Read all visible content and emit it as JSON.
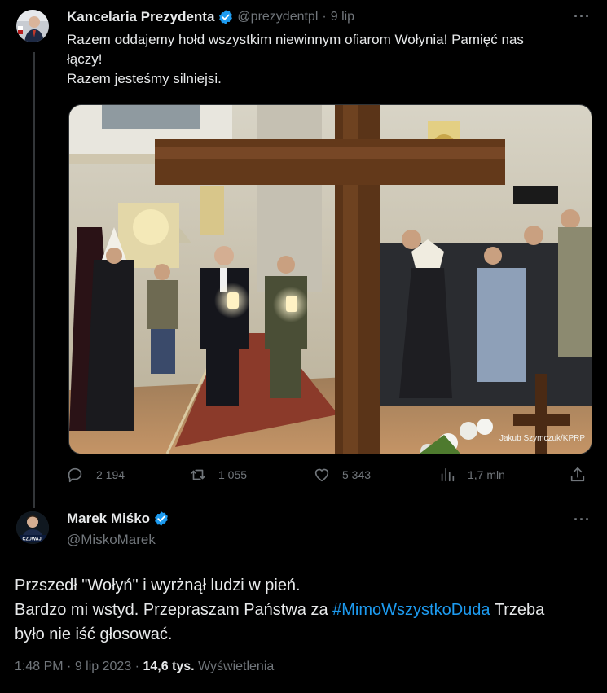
{
  "tweet1": {
    "author_name": "Kancelaria Prezydenta",
    "handle": "@prezydentpl",
    "separator": "·",
    "date": "9 lip",
    "more_icon": "more-horizontal-icon",
    "text_line1": "Razem oddajemy hołd wszystkim niewinnym ofiarom Wołynia! Pamięć nas",
    "text_line2": "łączy!",
    "text_line3": "Razem jesteśmy silniejsi.",
    "photo_credit": "Jakub Szymczuk/KPRP",
    "actions": {
      "replies": "2 194",
      "retweets": "1 055",
      "likes": "5 343",
      "views": "1,7 mln"
    }
  },
  "tweet2": {
    "author_name": "Marek Miśko",
    "handle": "@MiskoMarek",
    "avatar_caption": "CZUWAJ!",
    "text_line1": "Przszedł \"Wołyń\" i wyrżnął ludzi w pień.",
    "text_line2_before": "Bardzo mi wstyd. Przepraszam Państwa za ",
    "hashtag": "#MimoWszystkoDuda",
    "text_line2_after": " Trzeba",
    "text_line3": "było nie iść głosować.",
    "time": "1:48 PM",
    "date": "9 lip 2023",
    "views_count": "14,6 tys.",
    "views_label": "Wyświetlenia"
  },
  "colors": {
    "background": "#000000",
    "text": "#e7e9ea",
    "secondary": "#71767b",
    "accent": "#1d9bf0",
    "divider": "#2f3336"
  }
}
